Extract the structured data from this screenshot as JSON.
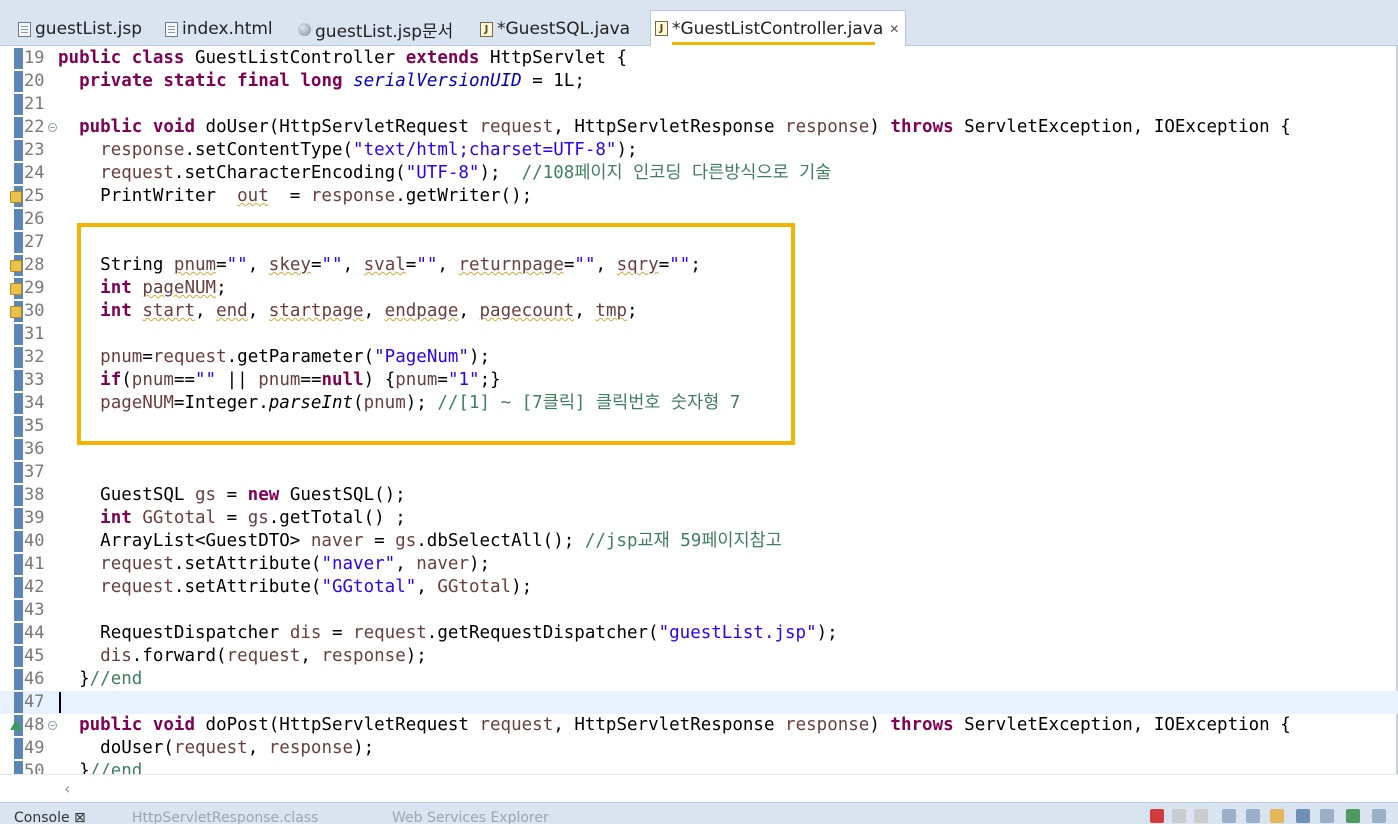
{
  "tabs": [
    {
      "label": "guestList.jsp",
      "icon": "file-icon"
    },
    {
      "label": "index.html",
      "icon": "file-icon"
    },
    {
      "label": "guestList.jsp문서",
      "icon": "globe-icon"
    },
    {
      "label": "*GuestSQL.java",
      "icon": "java-file-icon"
    },
    {
      "label": "*GuestListController.java",
      "icon": "java-file-icon",
      "active": true,
      "close": "✕"
    }
  ],
  "lines": [
    {
      "n": "19"
    },
    {
      "n": "20"
    },
    {
      "n": "21"
    },
    {
      "n": "22"
    },
    {
      "n": "23"
    },
    {
      "n": "24"
    },
    {
      "n": "25"
    },
    {
      "n": "26"
    },
    {
      "n": "27"
    },
    {
      "n": "28"
    },
    {
      "n": "29"
    },
    {
      "n": "30"
    },
    {
      "n": "31"
    },
    {
      "n": "32"
    },
    {
      "n": "33"
    },
    {
      "n": "34"
    },
    {
      "n": "35"
    },
    {
      "n": "36"
    },
    {
      "n": "37"
    },
    {
      "n": "38"
    },
    {
      "n": "39"
    },
    {
      "n": "40"
    },
    {
      "n": "41"
    },
    {
      "n": "42"
    },
    {
      "n": "43"
    },
    {
      "n": "44"
    },
    {
      "n": "45"
    },
    {
      "n": "46"
    },
    {
      "n": "47"
    },
    {
      "n": "48"
    },
    {
      "n": "49"
    },
    {
      "n": "50"
    }
  ],
  "code": {
    "l19": {
      "a": "public",
      "b": "class",
      "c": " GuestListController ",
      "d": "extends",
      "e": " HttpServlet {"
    },
    "l20": {
      "a": "private",
      "b": "static",
      "c": "final",
      "d": "long",
      "e": "serialVersionUID",
      "f": " = 1L;"
    },
    "l22": {
      "a": "public",
      "b": "void",
      "c": " doUser(HttpServletRequest ",
      "d": "request",
      "e": ", HttpServletResponse ",
      "f": "response",
      "g": ") ",
      "h": "throws",
      "i": " ServletException, IOException {"
    },
    "l23": {
      "a": "response",
      "b": ".setContentType(",
      "c": "\"text/html;charset=UTF-8\"",
      "d": ");"
    },
    "l24": {
      "a": "request",
      "b": ".setCharacterEncoding(",
      "c": "\"UTF-8\"",
      "d": ");  ",
      "e": "//108페이지 인코딩 다른방식으로 기술"
    },
    "l25": {
      "a": "PrintWriter  ",
      "b": "out",
      "c": "  = ",
      "d": "response",
      "e": ".getWriter();"
    },
    "l28": {
      "a": "String ",
      "b": "pnum",
      "c": "=",
      "d": "\"\"",
      "e": ", ",
      "f": "skey",
      "g": "=",
      "h": "\"\"",
      "i": ", ",
      "j": "sval",
      "k": "=",
      "l": "\"\"",
      "m": ", ",
      "n": "returnpage",
      "o": "=",
      "p": "\"\"",
      "q": ", ",
      "r": "sqry",
      "s": "=",
      "t": "\"\"",
      "u": ";"
    },
    "l29": {
      "a": "int",
      "b": " ",
      "c": "pageNUM",
      "d": ";"
    },
    "l30": {
      "a": "int",
      "b": " ",
      "c": "start",
      "d": ", ",
      "e": "end",
      "f": ", ",
      "g": "startpage",
      "h": ", ",
      "i": "endpage",
      "j": ", ",
      "k": "pagecount",
      "l": ", ",
      "m": "tmp",
      "n": ";"
    },
    "l32": {
      "a": "pnum",
      "b": "=",
      "c": "request",
      "d": ".getParameter(",
      "e": "\"PageNum\"",
      "f": ");"
    },
    "l33": {
      "a": "if",
      "b": "(",
      "c": "pnum",
      "d": "==",
      "e": "\"\"",
      "f": " || ",
      "g": "pnum",
      "h": "==",
      "i": "null",
      "j": ") {",
      "k": "pnum",
      "l": "=",
      "m": "\"1\"",
      "n": ";}"
    },
    "l34": {
      "a": "pageNUM",
      "b": "=Integer.",
      "c": "parseInt",
      "d": "(",
      "e": "pnum",
      "f": "); ",
      "g": "//[1] ~ [7클릭] 클릭번호 숫자형 7"
    },
    "l38": {
      "a": "GuestSQL ",
      "b": "gs",
      "c": " = ",
      "d": "new",
      "e": " GuestSQL();"
    },
    "l39": {
      "a": "int",
      "b": " ",
      "c": "GGtotal",
      "d": " = ",
      "e": "gs",
      "f": ".getTotal() ;"
    },
    "l40": {
      "a": "ArrayList<GuestDTO> ",
      "b": "naver",
      "c": " = ",
      "d": "gs",
      "e": ".dbSelectAll(); ",
      "f": "//jsp교재 59페이지참고"
    },
    "l41": {
      "a": "request",
      "b": ".setAttribute(",
      "c": "\"naver\"",
      "d": ", ",
      "e": "naver",
      "f": ");"
    },
    "l42": {
      "a": "request",
      "b": ".setAttribute(",
      "c": "\"GGtotal\"",
      "d": ", ",
      "e": "GGtotal",
      "f": ");"
    },
    "l44": {
      "a": "RequestDispatcher ",
      "b": "dis",
      "c": " = ",
      "d": "request",
      "e": ".getRequestDispatcher(",
      "f": "\"guestList.jsp\"",
      "g": ");"
    },
    "l45": {
      "a": "dis",
      "b": ".forward(",
      "c": "request",
      "d": ", ",
      "e": "response",
      "f": ");"
    },
    "l46": {
      "a": "}",
      "b": "//end"
    },
    "l48": {
      "a": "public",
      "b": "void",
      "c": " doPost(HttpServletRequest ",
      "d": "request",
      "e": ", HttpServletResponse ",
      "f": "response",
      "g": ") ",
      "h": "throws",
      "i": " ServletException, IOException {"
    },
    "l49": {
      "a": "doUser(",
      "b": "request",
      "c": ", ",
      "d": "response",
      "e": ");"
    },
    "l50": {
      "a": "}",
      "b": "//end"
    }
  },
  "bottom": {
    "scroll_arrow": "‹",
    "tab1": "Console ⊠",
    "tab2": "HttpServletResponse.class",
    "tab3": "Web Services Explorer"
  },
  "colors": {
    "keyword": "#7f0055",
    "string": "#2a00ff",
    "comment": "#3f7f5f",
    "field": "#0000c0",
    "highlight_box": "#f2b400"
  }
}
